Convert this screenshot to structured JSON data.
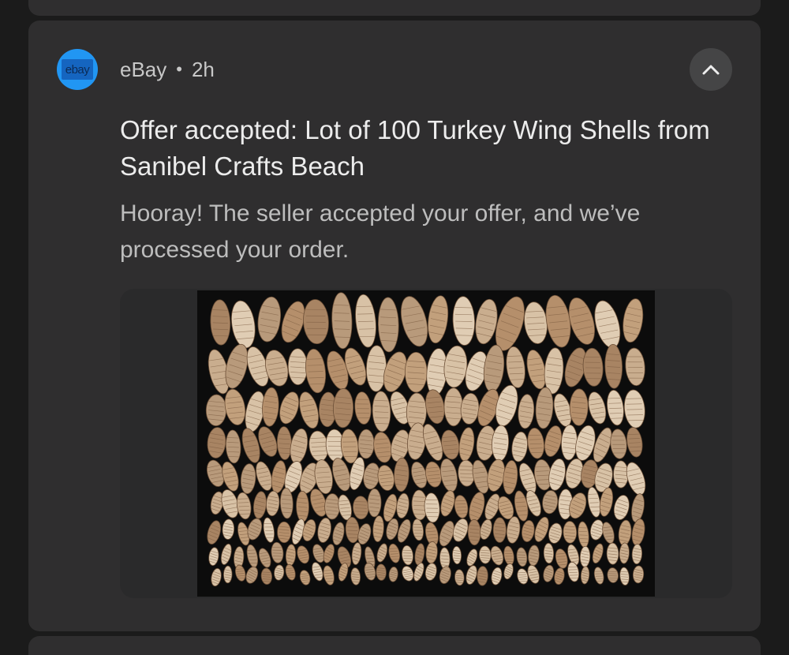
{
  "notification": {
    "app_name": "eBay",
    "separator": "•",
    "time": "2h",
    "app_icon_label": "ebay",
    "title": "Offer accepted: Lot of 100 Turkey Wing Shells from Sanibel Crafts Beach",
    "body": "Hooray! The seller accepted your offer, and we’ve processed your order.",
    "collapse_icon": "chevron-up-icon",
    "image_content": "turkey wing shells arranged in rows on black background"
  },
  "colors": {
    "background": "#1b1b1b",
    "card": "#2f2e2f",
    "accent_blue": "#2196f3",
    "title_text": "#ececec",
    "body_text": "#bdbdbd"
  }
}
